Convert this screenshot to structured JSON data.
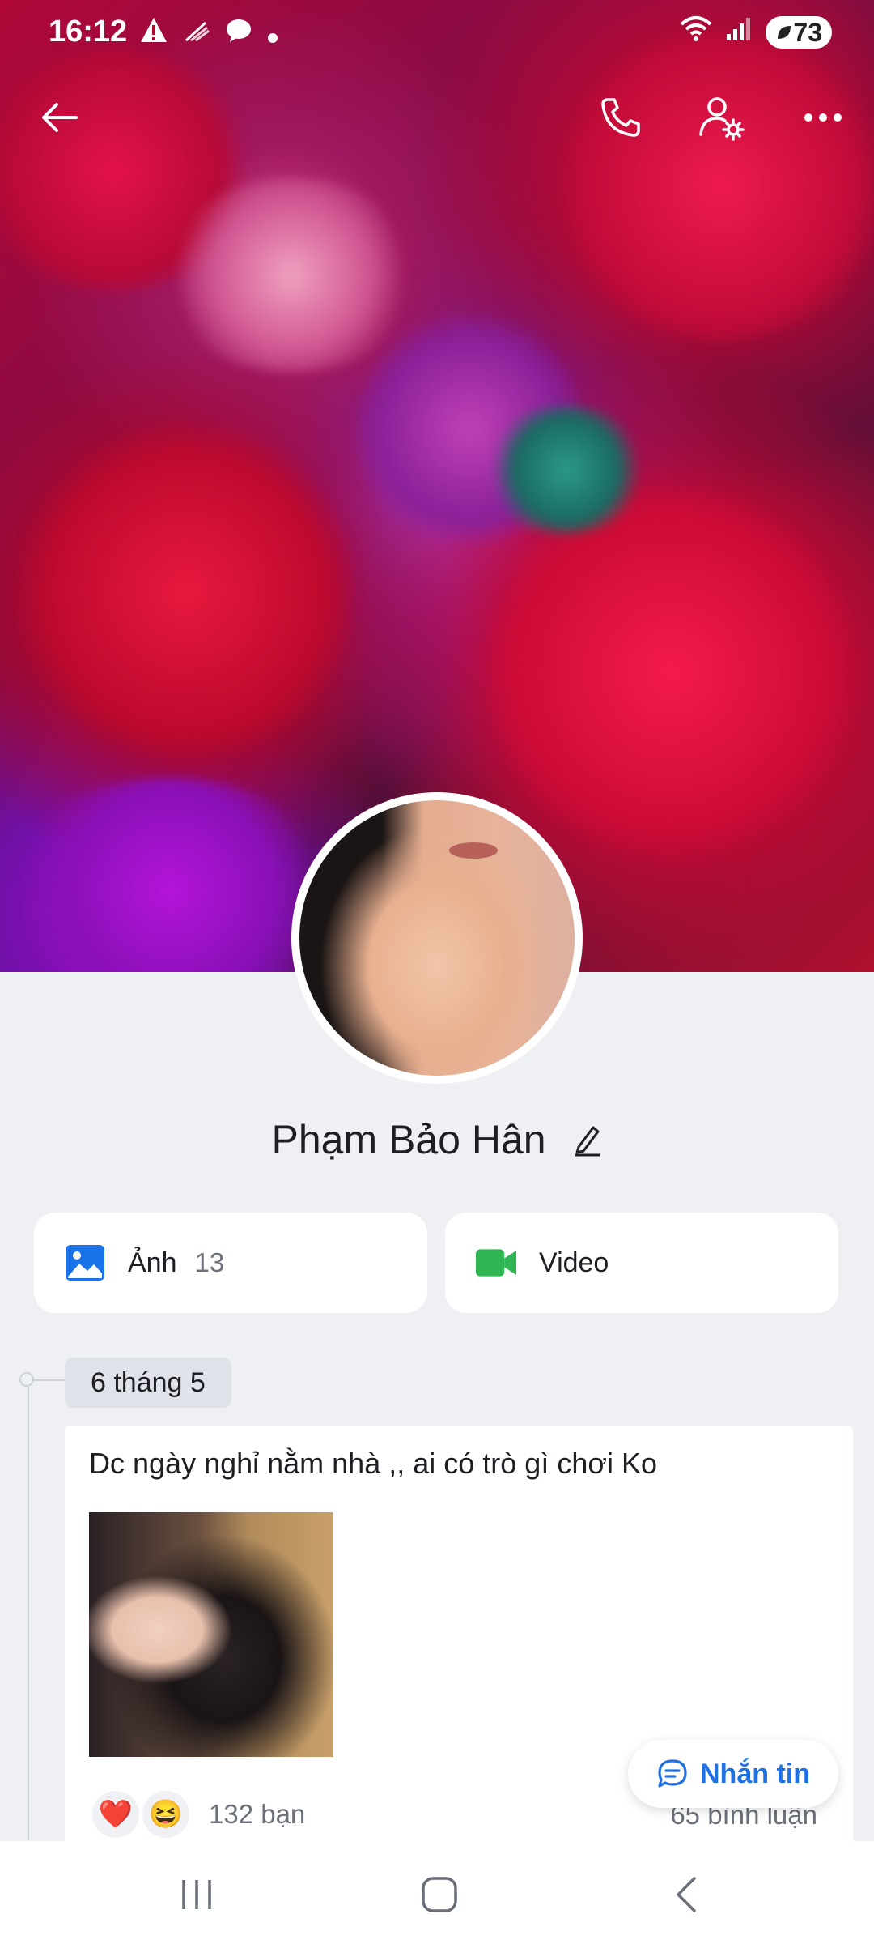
{
  "status_bar": {
    "time": "16:12",
    "battery": "73",
    "icons": [
      "alert-icon",
      "no-signal-icon",
      "chat-bubble-icon",
      "dot-icon",
      "wifi-icon",
      "cellular-icon"
    ]
  },
  "header": {
    "icons": [
      "back-arrow-icon",
      "phone-icon",
      "user-settings-icon",
      "more-icon"
    ]
  },
  "profile": {
    "name": "Phạm Bảo Hân"
  },
  "media": {
    "photos_label": "Ảnh",
    "photos_count": "13",
    "video_label": "Video"
  },
  "timeline": {
    "date": "6 tháng 5",
    "post": {
      "text": "Dc ngày nghỉ nằm nhà ,, ai có trò gì chơi Ko",
      "reactions": [
        "❤️",
        "😆"
      ],
      "friends_text": "132 bạn",
      "comments_text": "65 bình luận"
    }
  },
  "fab": {
    "label": "Nhắn tin"
  },
  "colors": {
    "accent": "#1f6fe5",
    "photo_icon": "#1a73e8",
    "video_icon": "#2fb553",
    "page_bg": "#eef0f4"
  }
}
